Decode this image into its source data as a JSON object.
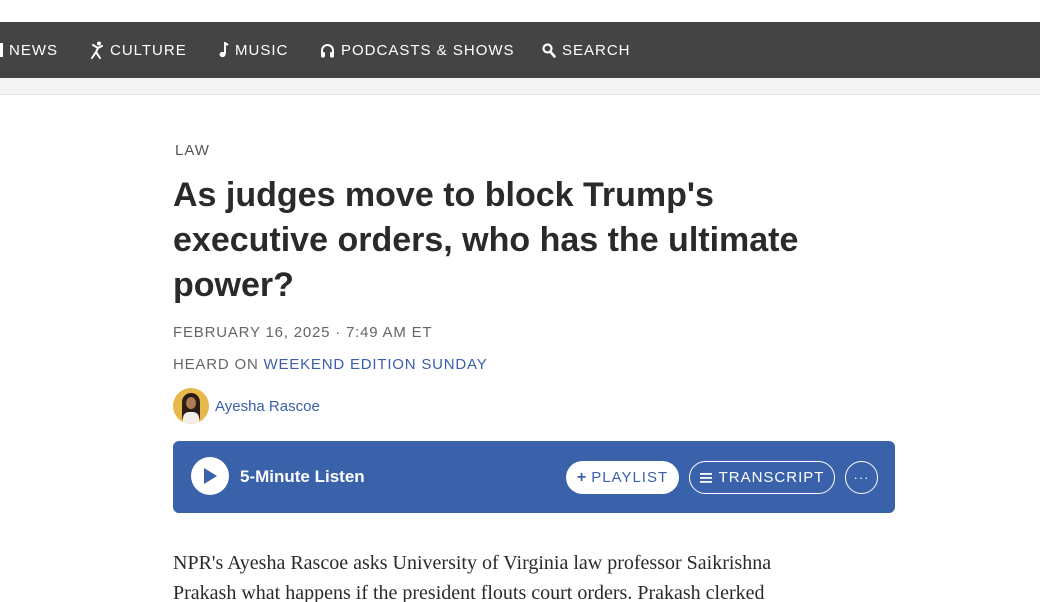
{
  "nav": {
    "items": [
      {
        "label": "NEWS",
        "icon": "news-icon"
      },
      {
        "label": "CULTURE",
        "icon": "culture-icon"
      },
      {
        "label": "MUSIC",
        "icon": "music-note-icon"
      },
      {
        "label": "PODCASTS & SHOWS",
        "icon": "headphones-icon"
      },
      {
        "label": "SEARCH",
        "icon": "search-icon"
      }
    ]
  },
  "article": {
    "section": "LAW",
    "headline": "As judges move to block Trump's executive orders, who has the ultimate power?",
    "dateline": "FEBRUARY 16, 2025 · 7:49 AM ET",
    "heard_on_prefix": "HEARD ON",
    "heard_on_show": "WEEKEND EDITION SUNDAY",
    "author": "Ayesha Rascoe",
    "body_line_1": "NPR's Ayesha Rascoe asks University of Virginia law professor Saikrishna",
    "body_line_2": "Prakash what happens if the president flouts court orders. Prakash clerked"
  },
  "player": {
    "listen_label": "5-Minute Listen",
    "playlist_label": "PLAYLIST",
    "transcript_label": "TRANSCRIPT",
    "more_label": "···"
  },
  "colors": {
    "nav_bg": "#444444",
    "player_bg": "#3a62ab",
    "link": "#3a5eab"
  }
}
